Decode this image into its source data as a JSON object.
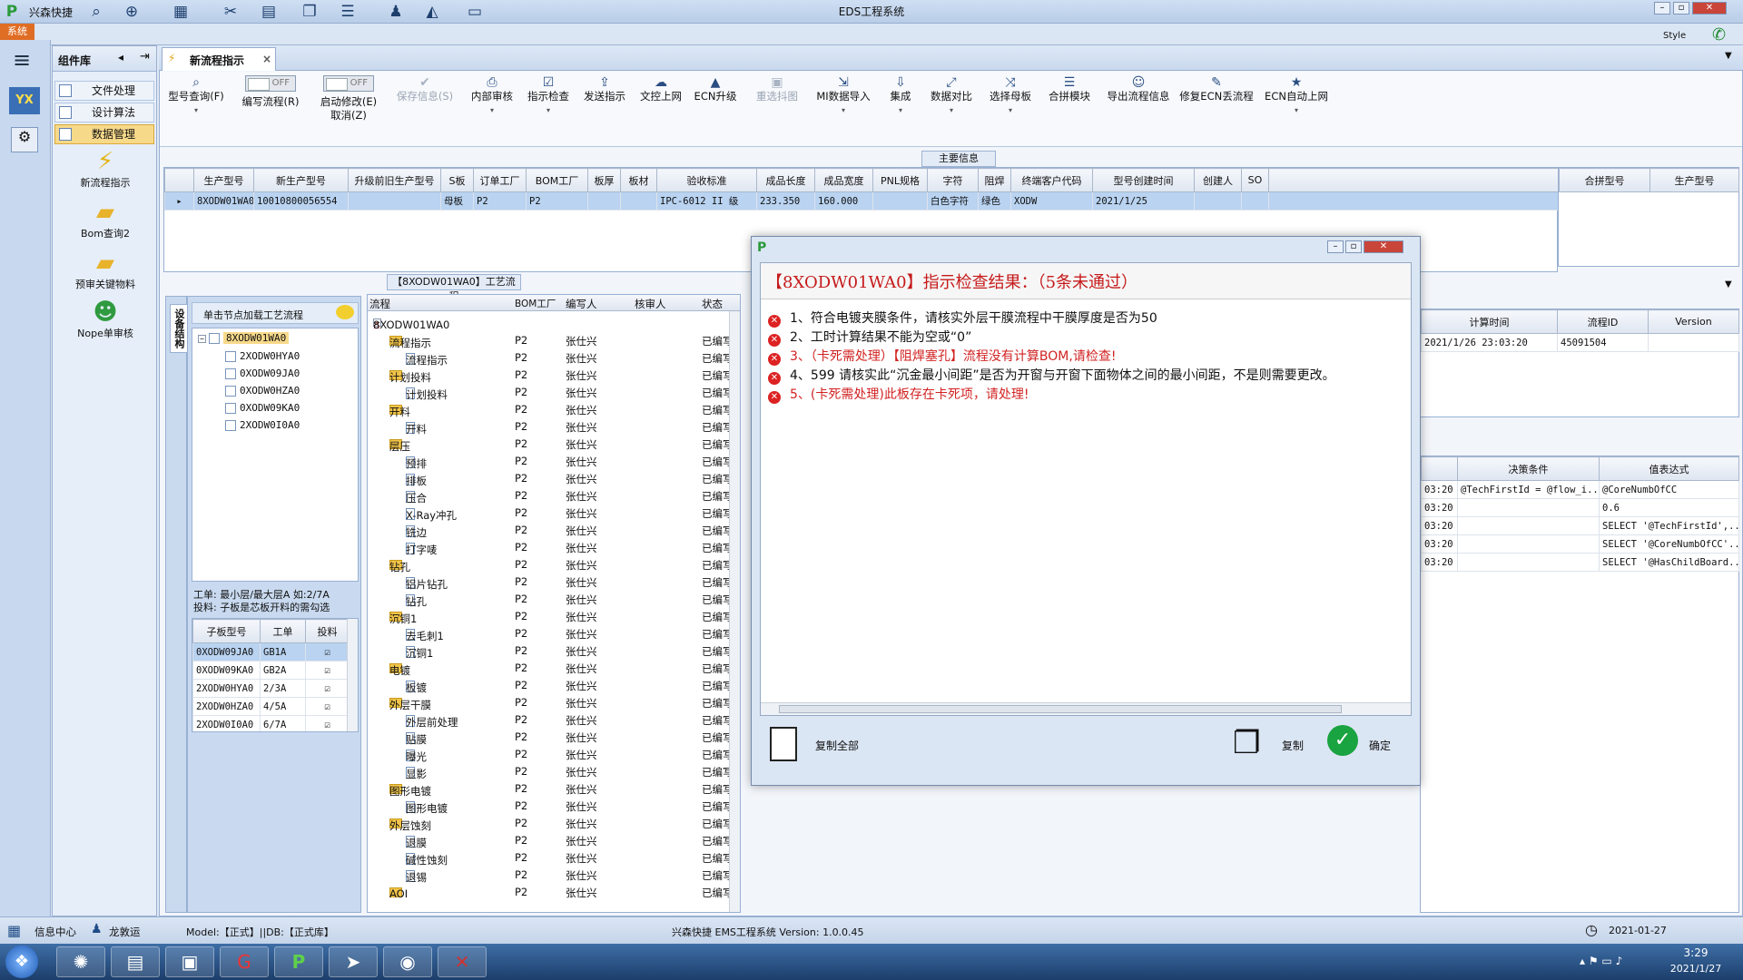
{
  "app": {
    "quick_access": "兴森快捷",
    "title": "EDS工程系统",
    "system_tab": "系统",
    "style_label": "Style"
  },
  "left_panel": {
    "title": "组件库",
    "menu": [
      "文件处理",
      "设计算法",
      "数据管理"
    ],
    "items": [
      "新流程指示",
      "Bom查询2",
      "预审关键物料",
      "Nope单审核"
    ]
  },
  "doc_tab": {
    "label": "新流程指示",
    "close": "×"
  },
  "toolbar": {
    "buttons": [
      {
        "label": "型号查询(F)",
        "sub": ""
      },
      {
        "label": "编写流程(R)",
        "toggle": "OFF"
      },
      {
        "label": "启动修改(E)",
        "sub": "取消(Z)",
        "toggle": "OFF"
      },
      {
        "label": "保存信息(S)"
      },
      {
        "label": "内部审核"
      },
      {
        "label": "指示检查"
      },
      {
        "label": "发送指示"
      },
      {
        "label": "文控上网"
      },
      {
        "label": "ECN升级"
      },
      {
        "label": "重选抖图"
      },
      {
        "label": "MI数据导入"
      },
      {
        "label": "集成"
      },
      {
        "label": "数据对比"
      },
      {
        "label": "选择母板"
      },
      {
        "label": "合拼模块"
      },
      {
        "label": "导出流程信息"
      },
      {
        "label": "修复ECN丢流程"
      },
      {
        "label": "ECN自动上网"
      }
    ]
  },
  "main_info": {
    "section": "主要信息",
    "columns": [
      "生产型号",
      "新生产型号",
      "升级前旧生产型号",
      "S板",
      "订单工厂",
      "BOM工厂",
      "板厚",
      "板材",
      "验收标准",
      "成品长度",
      "成品宽度",
      "PNL规格",
      "字符",
      "阻焊",
      "终端客户代码",
      "型号创建时间",
      "创建人",
      "SO"
    ],
    "row": [
      "8XODW01WA0",
      "10010800056554",
      "",
      "母板",
      "P2",
      "P2",
      "",
      "",
      "IPC-6012 II 级",
      "233.350",
      "160.000",
      "",
      "白色字符",
      "绿色",
      "XODW",
      "2021/1/25",
      "",
      ""
    ],
    "right_columns": [
      "合拼型号",
      "生产型号"
    ]
  },
  "flow_section": "【8XODW01WA0】工艺流程",
  "tree_panel": {
    "vertical_tab": "设备结构",
    "hint": "单击节点加载工艺流程",
    "root": "8XODW01WA0",
    "children": [
      "2XODW0HYA0",
      "0XODW09JA0",
      "0XODW0HZA0",
      "0XODW09KA0",
      "2XODW0I0A0"
    ],
    "note1": "工单: 最小层/最大层A 如:2/7A",
    "note2": "投料: 子板是芯板开料的需勾选",
    "sub_columns": [
      "子板型号",
      "工单",
      "投料"
    ],
    "sub_rows": [
      [
        "0XODW09JA0",
        "GB1A"
      ],
      [
        "0XODW09KA0",
        "GB2A"
      ],
      [
        "2XODW0HYA0",
        "2/3A"
      ],
      [
        "2XODW0HZA0",
        "4/5A"
      ],
      [
        "2XODW0I0A0",
        "6/7A"
      ]
    ]
  },
  "flow_table": {
    "columns": [
      "流程",
      "BOM工厂",
      "编写人",
      "核审人",
      "状态"
    ],
    "rows": [
      {
        "name": "8XODW01WA0",
        "level": 0,
        "type": "root"
      },
      {
        "name": "流程指示",
        "level": 1,
        "type": "folder"
      },
      {
        "name": "流程指示",
        "level": 2,
        "type": "doc"
      },
      {
        "name": "计划投料",
        "level": 1,
        "type": "folder"
      },
      {
        "name": "计划投料",
        "level": 2,
        "type": "doc"
      },
      {
        "name": "开料",
        "level": 1,
        "type": "folder"
      },
      {
        "name": "开料",
        "level": 2,
        "type": "doc"
      },
      {
        "name": "层压",
        "level": 1,
        "type": "folder"
      },
      {
        "name": "预排",
        "level": 2,
        "type": "doc"
      },
      {
        "name": "排板",
        "level": 2,
        "type": "doc"
      },
      {
        "name": "压合",
        "level": 2,
        "type": "doc"
      },
      {
        "name": "X-Ray冲孔",
        "level": 2,
        "type": "doc"
      },
      {
        "name": "铣边",
        "level": 2,
        "type": "doc"
      },
      {
        "name": "打字唛",
        "level": 2,
        "type": "doc"
      },
      {
        "name": "钻孔",
        "level": 1,
        "type": "folder"
      },
      {
        "name": "铝片钻孔",
        "level": 2,
        "type": "doc"
      },
      {
        "name": "钻孔",
        "level": 2,
        "type": "doc"
      },
      {
        "name": "沉铜1",
        "level": 1,
        "type": "folder"
      },
      {
        "name": "去毛刺1",
        "level": 2,
        "type": "doc"
      },
      {
        "name": "沉铜1",
        "level": 2,
        "type": "doc"
      },
      {
        "name": "电镀",
        "level": 1,
        "type": "folder"
      },
      {
        "name": "板镀",
        "level": 2,
        "type": "doc"
      },
      {
        "name": "外层干膜",
        "level": 1,
        "type": "folder"
      },
      {
        "name": "外层前处理",
        "level": 2,
        "type": "doc"
      },
      {
        "name": "贴膜",
        "level": 2,
        "type": "doc"
      },
      {
        "name": "曝光",
        "level": 2,
        "type": "doc"
      },
      {
        "name": "显影",
        "level": 2,
        "type": "doc"
      },
      {
        "name": "图形电镀",
        "level": 1,
        "type": "folder"
      },
      {
        "name": "图形电镀",
        "level": 2,
        "type": "doc"
      },
      {
        "name": "外层蚀刻",
        "level": 1,
        "type": "folder"
      },
      {
        "name": "退膜",
        "level": 2,
        "type": "doc"
      },
      {
        "name": "碱性蚀刻",
        "level": 2,
        "type": "doc"
      },
      {
        "name": "退锡",
        "level": 2,
        "type": "doc"
      },
      {
        "name": "AOI",
        "level": 1,
        "type": "folder"
      }
    ],
    "bom": "P2",
    "writer": "张仕兴",
    "status": "已编写"
  },
  "right_panel": {
    "calc_columns": [
      "计算时间",
      "流程ID",
      "Version"
    ],
    "calc_row": [
      "2021/1/26 23:03:20",
      "45091504",
      ""
    ],
    "cond_columns": [
      "决策条件",
      "值表达式"
    ],
    "cond_rows": [
      [
        "03:20",
        "@TechFirstId = @flow_i...",
        "@CoreNumbOfCC"
      ],
      [
        "03:20",
        "",
        "0.6"
      ],
      [
        "03:20",
        "",
        "SELECT '@TechFirstId',..."
      ],
      [
        "03:20",
        "",
        "SELECT '@CoreNumbOfCC'..."
      ],
      [
        "03:20",
        "",
        "SELECT '@HasChildBoard..."
      ]
    ]
  },
  "dialog": {
    "heading": "【8XODW01WA0】指示检查结果：（5条未通过）",
    "messages": [
      {
        "text": "1、符合电镀夹膜条件，请核实外层干膜流程中干膜厚度是否为50",
        "red": false
      },
      {
        "text": "2、工时计算结果不能为空或“0”",
        "red": false
      },
      {
        "text": "3、（卡死需处理）【阻焊塞孔】流程没有计算BOM,请检查!",
        "red": true
      },
      {
        "text": "4、599 请核实此“沉金最小间距”是否为开窗与开窗下面物体之间的最小间距，不是则需要更改。",
        "red": false
      },
      {
        "text": "5、(卡死需处理)此板存在卡死项，请处理!",
        "red": true
      }
    ],
    "copy_all": "复制全部",
    "copy": "复制",
    "ok": "确定"
  },
  "status": {
    "info_center": "信息中心",
    "user": "龙敦运",
    "model": "Model:【正式】||DB:【正式库】",
    "version": "兴森快捷 EMS工程系统 Version: 1.0.0.45",
    "date": "2021-01-27"
  },
  "taskbar": {
    "time": "3:29",
    "date": "2021/1/27"
  },
  "colors": {
    "accent": "#f7d98a",
    "error": "#d22222",
    "selection": "#b9d3f1",
    "ok": "#1aa341"
  }
}
